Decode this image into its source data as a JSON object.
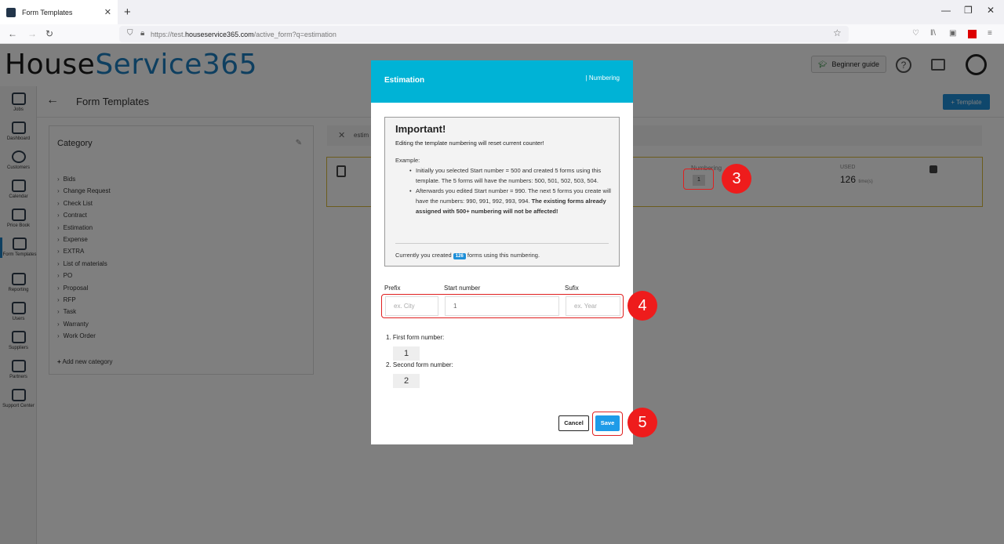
{
  "browser": {
    "tab_title": "Form Templates",
    "tab_close": "✕",
    "new_tab": "+",
    "url_prefix": "https://test.",
    "url_host": "houseservice365.com",
    "url_path": "/active_form?q=estimation"
  },
  "app": {
    "logo_part1": "House",
    "logo_part2": "Service365",
    "beginner_guide": "Beginner guide",
    "page_title": "Form Templates",
    "add_template": "+ Template"
  },
  "sidebar": {
    "items": [
      {
        "label": "Jobs"
      },
      {
        "label": "Dashboard"
      },
      {
        "label": "Customers"
      },
      {
        "label": "Calendar"
      },
      {
        "label": "Price Book"
      },
      {
        "label": "Form Templates"
      },
      {
        "label": "Reporting"
      },
      {
        "label": "Users"
      },
      {
        "label": "Suppliers"
      },
      {
        "label": "Partners"
      },
      {
        "label": "Support Center"
      }
    ]
  },
  "category": {
    "title": "Category",
    "items": [
      "Bids",
      "Change Request",
      "Check List",
      "Contract",
      "Estimation",
      "Expense",
      "EXTRA",
      "List of materials",
      "PO",
      "Proposal",
      "RFP",
      "Task",
      "Warranty",
      "Work Order"
    ],
    "add_new": "Add new category"
  },
  "search": {
    "value": "estim"
  },
  "template_row": {
    "numbering_label": "Numbering",
    "numbering_value": "1",
    "used_label": "USED",
    "used_value": "126",
    "used_unit": "time(s)"
  },
  "modal": {
    "title": "Estimation",
    "subtitle": "| Numbering",
    "important_title": "Important!",
    "important_warning": "Editing the template numbering will reset current counter!",
    "example_label": "Example:",
    "example_1": "Initially you selected Start number = 500 and created 5 forms using this template. The 5 forms will have the numbers: 500, 501, 502, 503, 504.",
    "example_2a": "Afterwards you edited Start number = 990. The next 5 forms you create will have the numbers: 990, 991, 992, 993, 994.",
    "example_2b": "The existing forms already assigned with 500+ numbering will not be affected!",
    "count_prefix": "Currently you created",
    "count_value": "126",
    "count_suffix": "forms using this numbering.",
    "prefix_label": "Prefix",
    "prefix_placeholder": "ex. City",
    "start_label": "Start number",
    "start_value": "1",
    "suffix_label": "Sufix",
    "suffix_placeholder": "ex. Year",
    "first_label": "1. First form number:",
    "first_value": "1",
    "second_label": "2. Second form number:",
    "second_value": "2",
    "cancel": "Cancel",
    "save": "Save"
  },
  "steps": [
    "3",
    "4",
    "5"
  ]
}
